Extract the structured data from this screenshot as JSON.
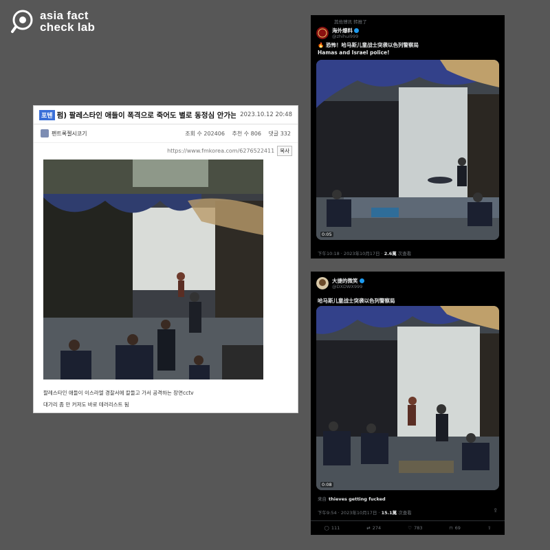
{
  "logo": {
    "line1": "asia fact",
    "line2": "check lab"
  },
  "forum": {
    "category": "포텐",
    "title": "펌) 팔레스타인 애들이 폭격으로 죽어도 별로 동정심 안가는 이유.gif",
    "date": "2023.10.12 20:48",
    "author": "펜트록젤시코기",
    "views_label": "조회 수 202406",
    "recommend_label": "추천 수 806",
    "comments_label": "댓글 332",
    "url": "https://www.fmkorea.com/6276522411",
    "copy_label": "복사",
    "caption1": "팔레스타인 애들이 이스라엘 경찰서에 칼들고 가서 공격하는 장면cctv",
    "caption2": "대가리 좀 만 커져도 바로 테러리스트 됨"
  },
  "tweet1": {
    "retweet": "其他博讯 转推了",
    "name": "海外爆料",
    "handle": "@zhihui999",
    "text_line1": "🔥 恐怖！哈马斯儿童战士突袭以色列警察局",
    "text_line2": "Hamas and Israel police!",
    "video_time": "0:05",
    "meta_time": "下午10:18 · 2023年10月17日 · ",
    "views": "2.6萬",
    "views_suffix": " 次查看"
  },
  "tweet2": {
    "name": "大捷的微笑",
    "handle": "@DXDWX999",
    "text": "哈马斯儿童战士突袭以色列警察局",
    "video_time": "0:08",
    "reply_prefix": "来自",
    "reply_text": "thieves getting fucked",
    "meta_time": "下午9:54 · 2023年10月17日 · ",
    "views": "15.1萬",
    "views_suffix": " 次查看",
    "replies": "111",
    "retweets": "274",
    "likes": "783",
    "bookmarks": "69"
  },
  "colors": {
    "background": "#575757",
    "forum_category": "#3a6fd8",
    "verified": "#1d9bf0"
  }
}
